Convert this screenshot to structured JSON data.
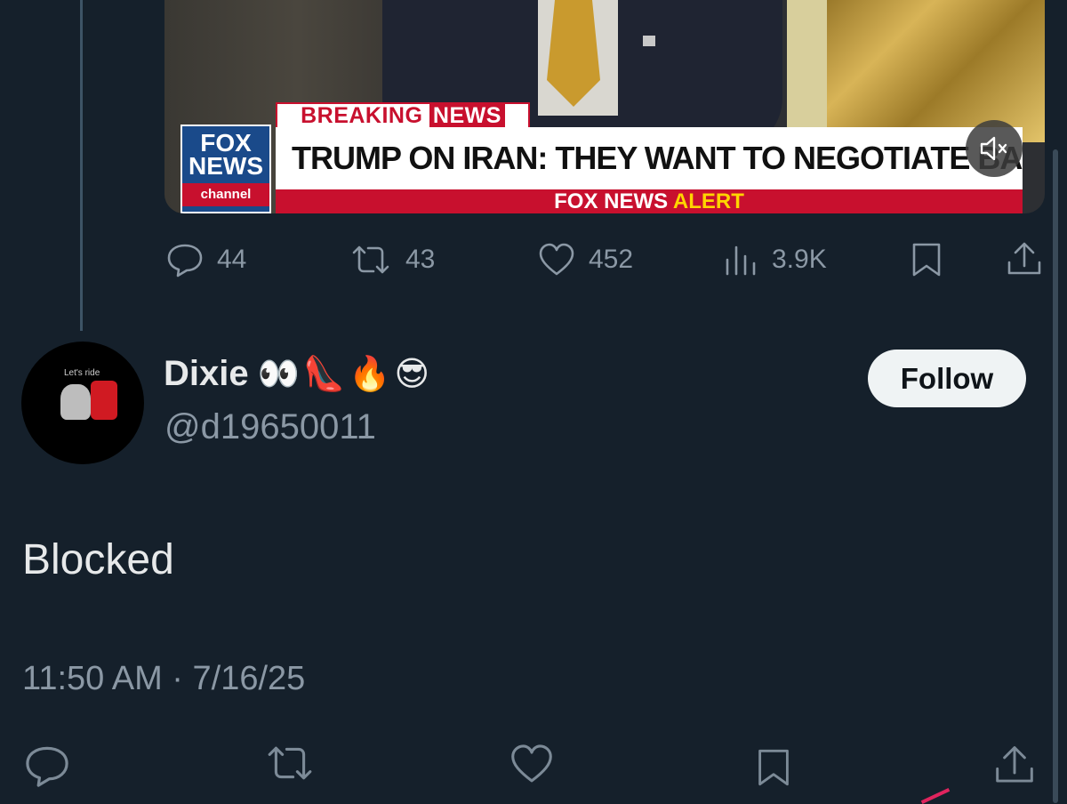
{
  "video": {
    "breaking_label_part1": "BREAKING ",
    "breaking_label_part2": "NEWS",
    "logo_line1": "FOX",
    "logo_line2": "NEWS",
    "logo_line3": "channel",
    "headline": "TRUMP ON IRAN: THEY WANT TO NEGOTIATE BADLY",
    "alert_part1": "FOX NEWS ",
    "alert_part2": "ALERT",
    "mute_icon": "speaker-muted-icon"
  },
  "original_actions": {
    "replies": "44",
    "reposts": "43",
    "likes": "452",
    "views": "3.9K"
  },
  "reply_tweet": {
    "avatar_caption": "Let's ride",
    "display_name": "Dixie",
    "name_emojis": "👀👠🔥😎",
    "handle": "@d19650011",
    "follow_label": "Follow",
    "text": "Blocked",
    "timestamp": "11:50 AM · 7/16/25"
  },
  "colors": {
    "background": "#15202b",
    "text_primary": "#e7e9ea",
    "text_secondary": "#8b98a5",
    "follow_bg": "#eff3f4"
  }
}
